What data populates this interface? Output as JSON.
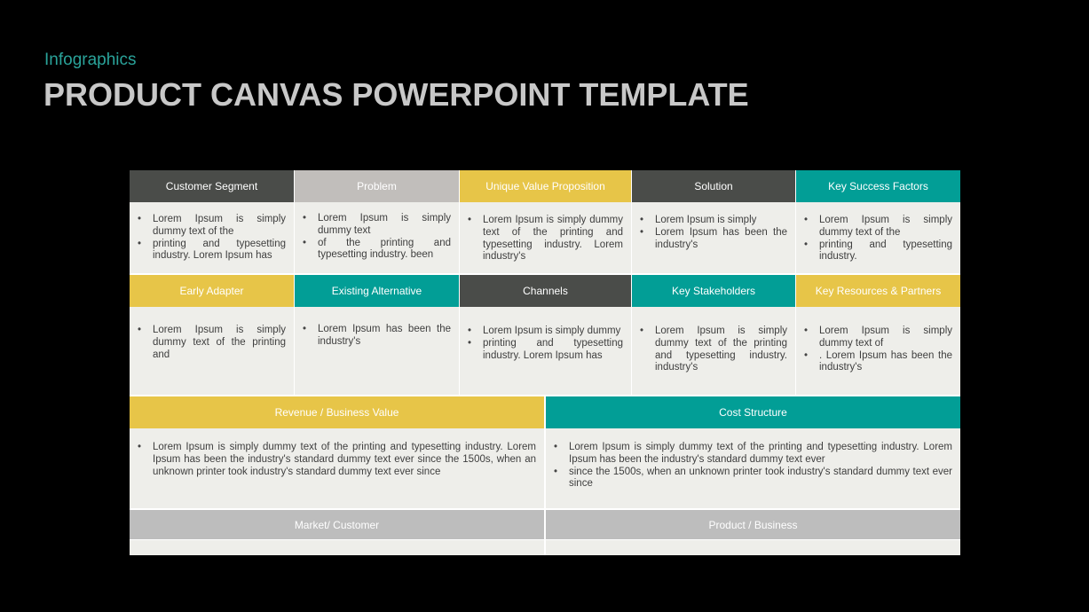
{
  "header": {
    "subtitle": "Infographics",
    "title": "PRODUCT CANVAS POWERPOINT TEMPLATE"
  },
  "colors": {
    "dark": "#4a4c49",
    "gray": "#c1bebb",
    "yellow": "#e7c548",
    "teal": "#029e96",
    "light_gray": "#bdbdbd",
    "cell_bg": "#eeeeea",
    "subtitle": "#2aa39a"
  },
  "row1": [
    {
      "title": "Customer Segment",
      "bullets": [
        "Lorem Ipsum is simply dummy text of the",
        "printing and typesetting industry. Lorem Ipsum has"
      ]
    },
    {
      "title": "Problem",
      "bullets": [
        "Lorem Ipsum is simply dummy text",
        "of the printing and typesetting industry. been"
      ]
    },
    {
      "title": "Unique Value Proposition",
      "bullets": [
        "Lorem Ipsum is simply dummy text of the printing and typesetting industry. Lorem industry's"
      ]
    },
    {
      "title": "Solution",
      "bullets": [
        "Lorem Ipsum is simply",
        "Lorem Ipsum has been the industry's"
      ]
    },
    {
      "title": "Key Success Factors",
      "bullets": [
        "Lorem Ipsum is simply dummy text of the",
        "printing and typesetting industry."
      ]
    }
  ],
  "row2": [
    {
      "title": "Early Adapter",
      "bullets": [
        "Lorem Ipsum is simply dummy text of the printing and"
      ]
    },
    {
      "title": "Existing Alternative",
      "bullets": [
        "Lorem Ipsum has been the industry's"
      ]
    },
    {
      "title": "Channels",
      "bullets": [
        "Lorem Ipsum is simply dummy",
        "printing and typesetting industry. Lorem Ipsum has"
      ]
    },
    {
      "title": "Key Stakeholders",
      "bullets": [
        "Lorem Ipsum is simply dummy text of the printing and typesetting industry. industry's"
      ]
    },
    {
      "title": "Key Resources & Partners",
      "bullets": [
        "Lorem Ipsum is simply dummy text of",
        ". Lorem Ipsum has been the industry's"
      ]
    }
  ],
  "row3": [
    {
      "title": "Revenue / Business Value",
      "bullets": [
        "Lorem Ipsum is simply dummy text of the printing and typesetting industry. Lorem Ipsum has been the industry's standard dummy text ever since the 1500s, when an unknown printer took industry's standard dummy text ever since"
      ]
    },
    {
      "title": "Cost Structure",
      "bullets": [
        "Lorem Ipsum is simply dummy text of the printing and typesetting industry. Lorem Ipsum has been the industry's standard dummy text ever",
        "since the 1500s, when an unknown printer took industry's standard dummy text ever since"
      ]
    }
  ],
  "footer": [
    {
      "title": "Market/ Customer"
    },
    {
      "title": "Product / Business"
    }
  ]
}
